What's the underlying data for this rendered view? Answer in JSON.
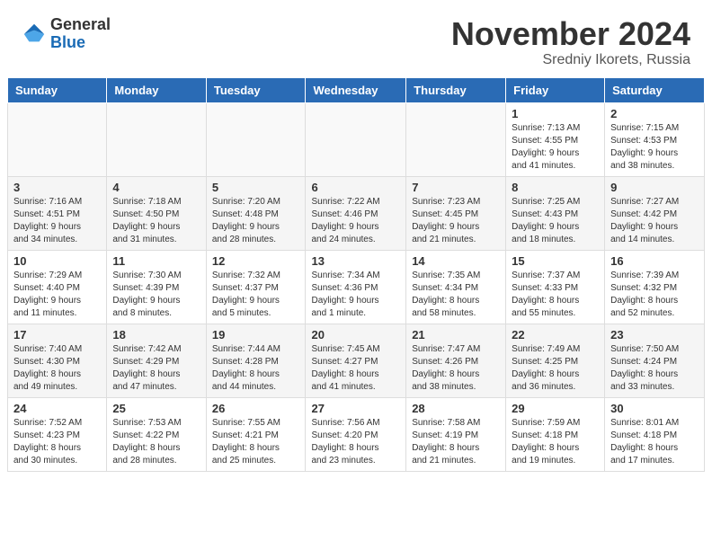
{
  "header": {
    "logo_general": "General",
    "logo_blue": "Blue",
    "month_title": "November 2024",
    "location": "Sredniy Ikorets, Russia"
  },
  "weekdays": [
    "Sunday",
    "Monday",
    "Tuesday",
    "Wednesday",
    "Thursday",
    "Friday",
    "Saturday"
  ],
  "weeks": [
    [
      {
        "day": "",
        "info": ""
      },
      {
        "day": "",
        "info": ""
      },
      {
        "day": "",
        "info": ""
      },
      {
        "day": "",
        "info": ""
      },
      {
        "day": "",
        "info": ""
      },
      {
        "day": "1",
        "info": "Sunrise: 7:13 AM\nSunset: 4:55 PM\nDaylight: 9 hours\nand 41 minutes."
      },
      {
        "day": "2",
        "info": "Sunrise: 7:15 AM\nSunset: 4:53 PM\nDaylight: 9 hours\nand 38 minutes."
      }
    ],
    [
      {
        "day": "3",
        "info": "Sunrise: 7:16 AM\nSunset: 4:51 PM\nDaylight: 9 hours\nand 34 minutes."
      },
      {
        "day": "4",
        "info": "Sunrise: 7:18 AM\nSunset: 4:50 PM\nDaylight: 9 hours\nand 31 minutes."
      },
      {
        "day": "5",
        "info": "Sunrise: 7:20 AM\nSunset: 4:48 PM\nDaylight: 9 hours\nand 28 minutes."
      },
      {
        "day": "6",
        "info": "Sunrise: 7:22 AM\nSunset: 4:46 PM\nDaylight: 9 hours\nand 24 minutes."
      },
      {
        "day": "7",
        "info": "Sunrise: 7:23 AM\nSunset: 4:45 PM\nDaylight: 9 hours\nand 21 minutes."
      },
      {
        "day": "8",
        "info": "Sunrise: 7:25 AM\nSunset: 4:43 PM\nDaylight: 9 hours\nand 18 minutes."
      },
      {
        "day": "9",
        "info": "Sunrise: 7:27 AM\nSunset: 4:42 PM\nDaylight: 9 hours\nand 14 minutes."
      }
    ],
    [
      {
        "day": "10",
        "info": "Sunrise: 7:29 AM\nSunset: 4:40 PM\nDaylight: 9 hours\nand 11 minutes."
      },
      {
        "day": "11",
        "info": "Sunrise: 7:30 AM\nSunset: 4:39 PM\nDaylight: 9 hours\nand 8 minutes."
      },
      {
        "day": "12",
        "info": "Sunrise: 7:32 AM\nSunset: 4:37 PM\nDaylight: 9 hours\nand 5 minutes."
      },
      {
        "day": "13",
        "info": "Sunrise: 7:34 AM\nSunset: 4:36 PM\nDaylight: 9 hours\nand 1 minute."
      },
      {
        "day": "14",
        "info": "Sunrise: 7:35 AM\nSunset: 4:34 PM\nDaylight: 8 hours\nand 58 minutes."
      },
      {
        "day": "15",
        "info": "Sunrise: 7:37 AM\nSunset: 4:33 PM\nDaylight: 8 hours\nand 55 minutes."
      },
      {
        "day": "16",
        "info": "Sunrise: 7:39 AM\nSunset: 4:32 PM\nDaylight: 8 hours\nand 52 minutes."
      }
    ],
    [
      {
        "day": "17",
        "info": "Sunrise: 7:40 AM\nSunset: 4:30 PM\nDaylight: 8 hours\nand 49 minutes."
      },
      {
        "day": "18",
        "info": "Sunrise: 7:42 AM\nSunset: 4:29 PM\nDaylight: 8 hours\nand 47 minutes."
      },
      {
        "day": "19",
        "info": "Sunrise: 7:44 AM\nSunset: 4:28 PM\nDaylight: 8 hours\nand 44 minutes."
      },
      {
        "day": "20",
        "info": "Sunrise: 7:45 AM\nSunset: 4:27 PM\nDaylight: 8 hours\nand 41 minutes."
      },
      {
        "day": "21",
        "info": "Sunrise: 7:47 AM\nSunset: 4:26 PM\nDaylight: 8 hours\nand 38 minutes."
      },
      {
        "day": "22",
        "info": "Sunrise: 7:49 AM\nSunset: 4:25 PM\nDaylight: 8 hours\nand 36 minutes."
      },
      {
        "day": "23",
        "info": "Sunrise: 7:50 AM\nSunset: 4:24 PM\nDaylight: 8 hours\nand 33 minutes."
      }
    ],
    [
      {
        "day": "24",
        "info": "Sunrise: 7:52 AM\nSunset: 4:23 PM\nDaylight: 8 hours\nand 30 minutes."
      },
      {
        "day": "25",
        "info": "Sunrise: 7:53 AM\nSunset: 4:22 PM\nDaylight: 8 hours\nand 28 minutes."
      },
      {
        "day": "26",
        "info": "Sunrise: 7:55 AM\nSunset: 4:21 PM\nDaylight: 8 hours\nand 25 minutes."
      },
      {
        "day": "27",
        "info": "Sunrise: 7:56 AM\nSunset: 4:20 PM\nDaylight: 8 hours\nand 23 minutes."
      },
      {
        "day": "28",
        "info": "Sunrise: 7:58 AM\nSunset: 4:19 PM\nDaylight: 8 hours\nand 21 minutes."
      },
      {
        "day": "29",
        "info": "Sunrise: 7:59 AM\nSunset: 4:18 PM\nDaylight: 8 hours\nand 19 minutes."
      },
      {
        "day": "30",
        "info": "Sunrise: 8:01 AM\nSunset: 4:18 PM\nDaylight: 8 hours\nand 17 minutes."
      }
    ]
  ]
}
